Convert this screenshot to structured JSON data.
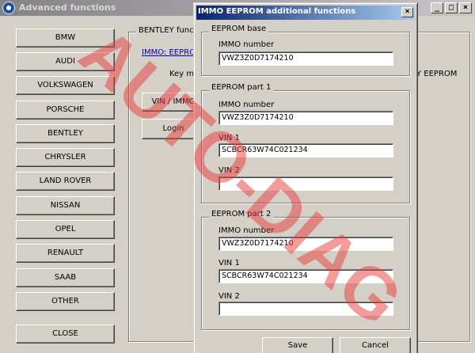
{
  "main_window": {
    "title": "Advanced functions",
    "title_buttons": {
      "minimize": "_",
      "maximize": "□",
      "close": "×"
    },
    "brands": [
      "BMW",
      "AUDI",
      "VOLKSWAGEN",
      "PORSCHE",
      "BENTLEY",
      "CHRYSLER",
      "LAND ROVER",
      "NISSAN",
      "OPEL",
      "RENAULT",
      "SAAB",
      "OTHER"
    ],
    "close_label": "CLOSE",
    "group_label": "BENTLEY functi",
    "link_label": "IMMO: EEPRO",
    "key_text": "Key m",
    "right_text": "Y EEPROM",
    "vin_immo_button": "VIN / IMMO",
    "login_button": "Login"
  },
  "dialog": {
    "title": "IMMO EEPROM additional functions",
    "close_symbol": "×",
    "sections": {
      "base": {
        "title": "EEPROM base",
        "immo_label": "IMMO number",
        "immo_value": "VWZ3Z0D7174210"
      },
      "part1": {
        "title": "EEPROM part 1",
        "immo_label": "IMMO number",
        "immo_value": "VWZ3Z0D7174210",
        "vin1_label": "VIN 1",
        "vin1_value": "SCBCR63W74C021234",
        "vin2_label": "VIN 2",
        "vin2_value": ""
      },
      "part2": {
        "title": "EEPROM part 2",
        "immo_label": "IMMO number",
        "immo_value": "VWZ3Z0D7174210",
        "vin1_label": "VIN 1",
        "vin1_value": "SCBCR63W74C021234",
        "vin2_label": "VIN 2",
        "vin2_value": ""
      }
    },
    "save_label": "Save",
    "cancel_label": "Cancel"
  },
  "watermark": {
    "text": "AUTO-DIAG",
    "color": "#e83a3a"
  }
}
